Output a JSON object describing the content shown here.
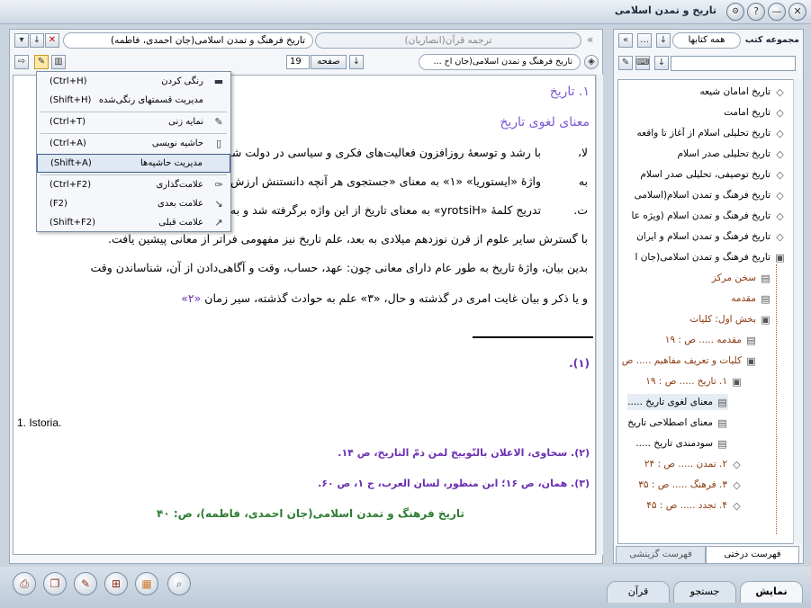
{
  "window": {
    "title": "تاریخ و تمدن اسلامی"
  },
  "doc_tabs": {
    "active": "تاریخ فرهنگ و تمدن اسلامی(جان احمدی، فاطمه)",
    "inactive": "ترجمه قرآن(انصاریان)"
  },
  "doc_toolbar": {
    "book_select": "تاریخ فرهنگ و تمدن اسلامی(جان اح ...",
    "page_label": "صفحه",
    "page_value": "19"
  },
  "context_menu": {
    "items": [
      {
        "label": "رنگی کردن",
        "shortcut": "(Ctrl+H)",
        "icon": "highlight-icon"
      },
      {
        "label": "مدیریت قسمتهای رنگی‌شده",
        "shortcut": "(Shift+H)",
        "icon": ""
      },
      {
        "label": "نمایه زنی",
        "shortcut": "(Ctrl+T)",
        "icon": "index-icon"
      },
      {
        "label": "حاشیه نویسی",
        "shortcut": "(Ctrl+A)",
        "icon": "note-icon"
      },
      {
        "label": "مدیریت حاشیه‌ها",
        "shortcut": "(Shift+A)",
        "icon": ""
      },
      {
        "label": "علامت‌گذاری",
        "shortcut": "(Ctrl+F2)",
        "icon": "bookmark-icon"
      },
      {
        "label": "علامت بعدی",
        "shortcut": "(F2)",
        "icon": "next-bookmark-icon"
      },
      {
        "label": "علامت قبلی",
        "shortcut": "(Shift+F2)",
        "icon": "prev-bookmark-icon"
      }
    ]
  },
  "content": {
    "heading1": "۱. تاریخ",
    "heading2": "معنای لغوی تاریخ",
    "line1": "با رشد و توسعهٔ روزافزون فعالیت‌های فکری و سیاسی در دولت شهر",
    "line1_tail": "لا،",
    "line2": "واژهٔ «ایستوریا» «۱» به معنای «جستجوی هر آنچه دانستنش ارزش",
    "line2_tail": "به",
    "line3": "تدریج کلمهٔ «yrotsiH» به معنای تاریخ از این واژه برگرفته شد و به عن",
    "line3_tail": "ت.",
    "line4": "با گسترش سایر علوم از قرن نوزدهم میلادی به بعد، علم تاریخ نیز مفهومی فراتر از معانی پیشین یافت.",
    "line5": "بدین بیان، واژهٔ تاریخ به طور عام دارای معانی چون: عهد، حساب، وقت و آگاهی‌دادن از آن، شناساندن وقت",
    "line6_ref": "«۲»",
    "line6": "و یا ذکر و بیان غایت امری در گذشته و حال، «۳» علم به حوادث گذشته، سیر زمان",
    "fn1_mark": "(۱).",
    "fn_latin": "1. Istoria.",
    "fn2": "(۲). سخاوی، الاعلان بالتّوبیخ لمن ذمّ التاریخ، ص ۱۴.",
    "fn3": "(۳). همان، ص ۱۶؛ ابن منظور، لسان العرب، ج ۱، ص ۶۰.",
    "page_footer": "تاریخ فرهنگ و تمدن اسلامی(جان احمدی، فاطمه)، ص: ۴۰"
  },
  "side_panel": {
    "header": "مجموعه کتب",
    "dropdown": "همه کتابها",
    "search_placeholder": "",
    "tree": [
      {
        "label": "تاریخ امامان شیعه",
        "level": 0
      },
      {
        "label": "تاریخ امامت",
        "level": 0
      },
      {
        "label": "تاریخ تحلیلی اسلام از آغاز تا واقعه",
        "level": 0
      },
      {
        "label": "تاریخ تحلیلی صدر اسلام",
        "level": 0
      },
      {
        "label": "تاریخ توصیفی، تحلیلی صدر اسلام",
        "level": 0
      },
      {
        "label": "تاریخ فرهنگ و تمدن اسلام(اسلامی",
        "level": 0
      },
      {
        "label": "تاریخ فرهنگ و تمدن اسلام (ویژه عا",
        "level": 0
      },
      {
        "label": "تاریخ فرهنگ و تمدن اسلام و ایران",
        "level": 0
      },
      {
        "label": "تاریخ فرهنگ و تمدن اسلامی(جان ا",
        "level": 0
      },
      {
        "label": "سخن مرکز",
        "level": 1
      },
      {
        "label": "مقدمه",
        "level": 1
      },
      {
        "label": "بخش اول: کلیات",
        "level": 1
      },
      {
        "label": "مقدمه ..... ص : ۱۹",
        "level": 2
      },
      {
        "label": "کلیات و تعریف مفاهیم ..... ص : ۱۹",
        "level": 2
      },
      {
        "label": "۱. تاریخ ..... ص : ۱۹",
        "level": 3
      },
      {
        "label": "معنای لغوی تاریخ .....",
        "level": 4
      },
      {
        "label": "معنای اصطلاحی تاریخ",
        "level": 4
      },
      {
        "label": "سودمندی تاریخ .....",
        "level": 4
      },
      {
        "label": "۲. تمدن ..... ص : ۲۴",
        "level": 3
      },
      {
        "label": "۳. فرهنگ ..... ص : ۳۵",
        "level": 3
      },
      {
        "label": "۴. تجدد ..... ص : ۴۵",
        "level": 3
      }
    ],
    "tabs": [
      "فهرست درختی",
      "فهرست گزینشی"
    ]
  },
  "bottom_tabs": [
    "نمایش",
    "جستجو",
    "قرآن"
  ],
  "colors": {
    "heading": "#7b5bd6",
    "footnote": "#6a2fb0",
    "footer": "#2e7d32",
    "tree_brown": "#8b3a10",
    "menu_highlight": "#dfe8f3"
  }
}
